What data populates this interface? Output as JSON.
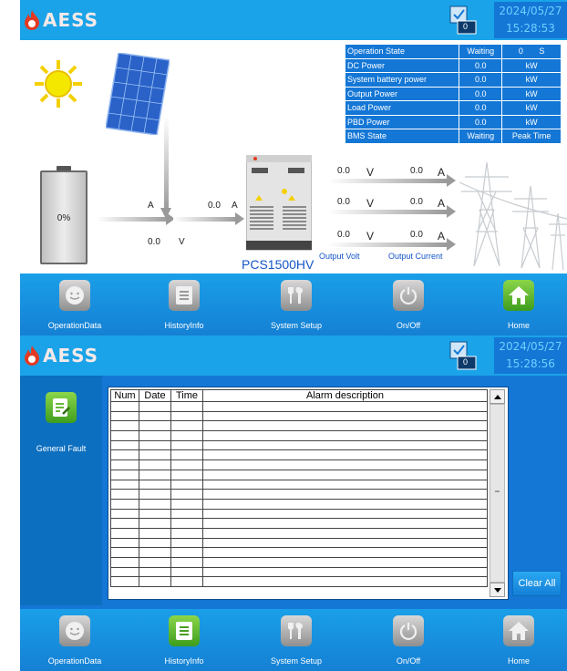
{
  "brand": {
    "logo_text": "AESS"
  },
  "screen1": {
    "connection": {
      "count": "0"
    },
    "datetime": {
      "date": "2024/05/27",
      "time": "15:28:53"
    },
    "status_table": [
      {
        "label": "Operation State",
        "value": "Waiting",
        "v2": "0",
        "v3": "S"
      },
      {
        "label": "DC Power",
        "value": "0.0",
        "v2": "kW",
        "v3": ""
      },
      {
        "label": "System battery power",
        "value": "0.0",
        "v2": "kW",
        "v3": ""
      },
      {
        "label": "Output Power",
        "value": "0.0",
        "v2": "kW",
        "v3": ""
      },
      {
        "label": "Load Power",
        "value": "0.0",
        "v2": "kW",
        "v3": ""
      },
      {
        "label": "PBD Power",
        "value": "0.0",
        "v2": "kW",
        "v3": ""
      },
      {
        "label": "BMS State",
        "value": "Waiting",
        "v2": "Peak Time",
        "v3": ""
      }
    ],
    "flow": {
      "battery_soc": "0%",
      "batt_current_unit": "A",
      "pv_current_value": "0.0",
      "pv_current_unit": "A",
      "batt_voltage_value": "0.0",
      "batt_voltage_unit": "V",
      "out1_v": "0.0",
      "out1_v_unit": "V",
      "out1_a": "0.0",
      "out1_a_unit": "A",
      "out2_v": "0.0",
      "out2_v_unit": "V",
      "out2_a": "0.0",
      "out2_a_unit": "A",
      "out3_v": "0.0",
      "out3_v_unit": "V",
      "out3_a": "0.0",
      "out3_a_unit": "A",
      "pcs_model": "PCS1500HV",
      "output_volt_label": "Output Volt",
      "output_current_label": "Output Current"
    }
  },
  "screen2": {
    "connection": {
      "count": "0"
    },
    "datetime": {
      "date": "2024/05/27",
      "time": "15:28:56"
    },
    "side_label": "General Fault",
    "alarm_columns": [
      "Num",
      "Date",
      "Time",
      "Alarm description"
    ],
    "clear_all": "Clear All"
  },
  "nav": {
    "operation_data": "OperationData",
    "history_info": "HistoryInfo",
    "system_setup": "System Setup",
    "on_off": "On/Off",
    "home": "Home"
  },
  "colors": {
    "header": "#1aa3e8",
    "panel": "#1477d6",
    "active_nav": "#3e9d1d"
  }
}
